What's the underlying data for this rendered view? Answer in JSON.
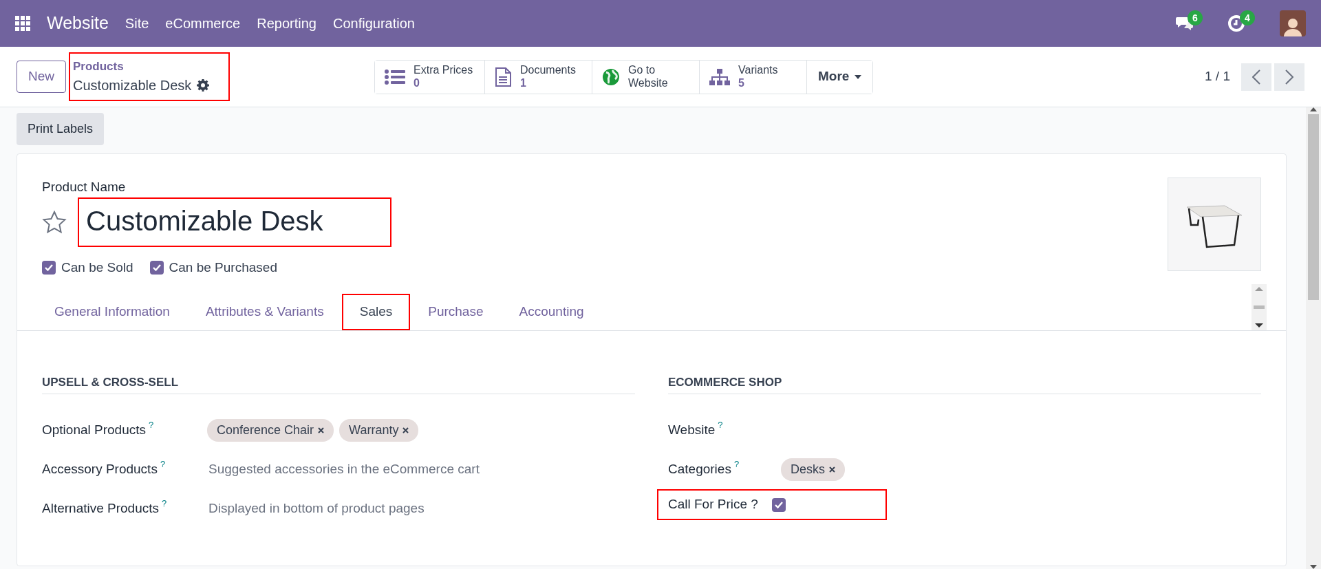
{
  "navbar": {
    "app": "Website",
    "menu": [
      "Site",
      "eCommerce",
      "Reporting",
      "Configuration"
    ],
    "badges": [
      {
        "kind": "chat",
        "count": "6"
      },
      {
        "kind": "activity",
        "count": "4"
      }
    ]
  },
  "control_panel": {
    "new_button": "New",
    "breadcrumb": {
      "parent": "Products",
      "current": "Customizable Desk",
      "highlighted": true
    },
    "smart_buttons": [
      {
        "kind": "list",
        "label": "Extra Prices",
        "value": "0"
      },
      {
        "kind": "document",
        "label": "Documents",
        "value": "1"
      },
      {
        "kind": "globe",
        "label": "Go to Website"
      },
      {
        "kind": "hierarchy",
        "label": "Variants",
        "value": "5"
      }
    ],
    "more": "More",
    "pager": "1 / 1"
  },
  "print_labels": "Print Labels",
  "form": {
    "name_label": "Product Name",
    "name": "Customizable Desk",
    "name_highlighted": true,
    "favorite": false,
    "checkboxes": [
      {
        "label": "Can be Sold",
        "checked": true
      },
      {
        "label": "Can be Purchased",
        "checked": true
      }
    ],
    "tabs": [
      {
        "label": "General Information",
        "selected": false,
        "highlighted": false
      },
      {
        "label": "Attributes & Variants",
        "selected": false,
        "highlighted": false
      },
      {
        "label": "Sales",
        "selected": true,
        "highlighted": true
      },
      {
        "label": "Purchase",
        "selected": false,
        "highlighted": false
      },
      {
        "label": "Accounting",
        "selected": false,
        "highlighted": false
      }
    ],
    "sections": [
      {
        "title": "UPSELL & CROSS-SELL",
        "fields": [
          {
            "kind": "tags",
            "label": "Optional Products",
            "help": "?",
            "tags": [
              "Conference Chair",
              "Warranty"
            ]
          },
          {
            "kind": "text",
            "label": "Accessory Products",
            "help": "?",
            "placeholder": "Suggested accessories in the eCommerce cart"
          },
          {
            "kind": "text",
            "label": "Alternative Products",
            "help": "?",
            "placeholder": "Displayed in bottom of product pages"
          }
        ]
      },
      {
        "title": "ECOMMERCE SHOP",
        "fields": [
          {
            "kind": "text",
            "label": "Website",
            "help": "?"
          },
          {
            "kind": "tags",
            "label": "Categories",
            "help": "?",
            "tags": [
              "Desks"
            ]
          },
          {
            "kind": "checkbox",
            "label": "Call For Price ?",
            "checked": true,
            "highlighted": true
          }
        ]
      }
    ]
  }
}
